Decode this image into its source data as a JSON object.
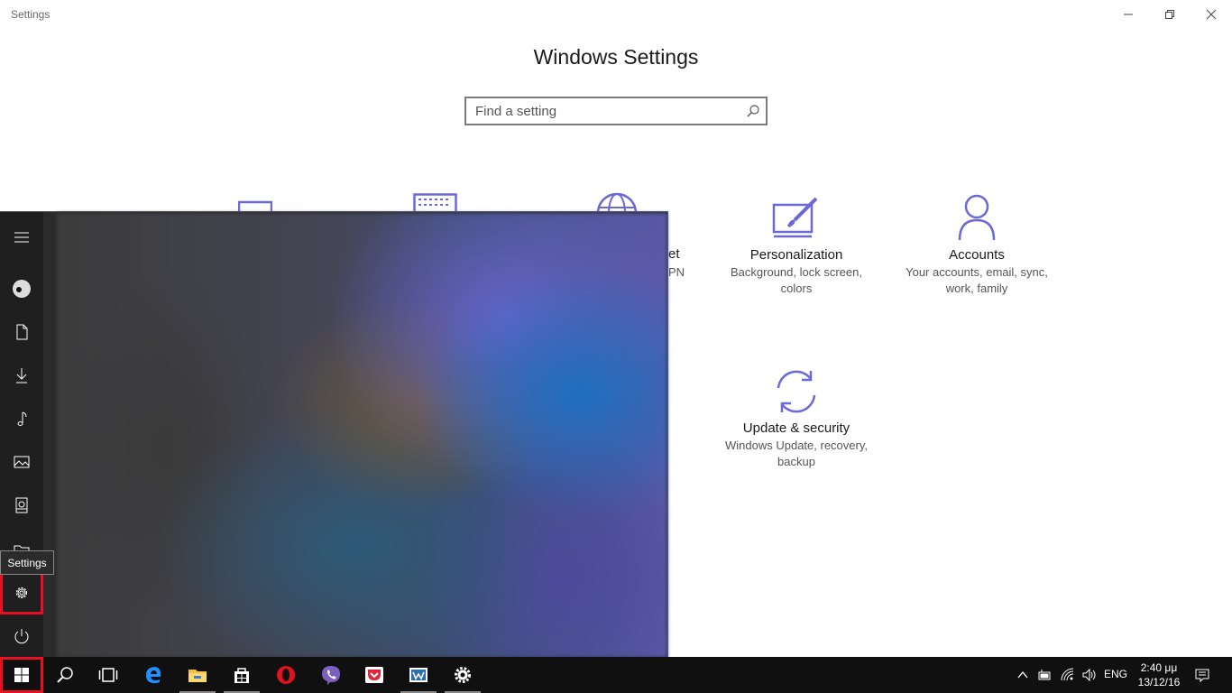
{
  "window": {
    "title": "Settings",
    "controls": [
      "minimize",
      "restore",
      "close"
    ]
  },
  "page": {
    "title": "Windows Settings"
  },
  "search": {
    "placeholder": "Find a setting"
  },
  "tiles": [
    {
      "title": "Personalization",
      "desc": "Background, lock screen, colors",
      "icon": "personalization-icon"
    },
    {
      "title": "Accounts",
      "desc": "Your accounts, email, sync, work, family",
      "icon": "accounts-icon"
    },
    {
      "title": "Update & security",
      "desc": "Windows Update, recovery, backup",
      "icon": "update-security-icon"
    }
  ],
  "partial": {
    "network_title_fragment": "et",
    "network_desc_fragment": "PN"
  },
  "start_menu": {
    "rail_items": [
      "hamburger-icon",
      "user-avatar-icon",
      "documents-icon",
      "downloads-icon",
      "music-icon",
      "pictures-icon",
      "videos-icon",
      "file-explorer-icon",
      "settings-icon",
      "power-icon"
    ],
    "tooltip": "Settings"
  },
  "taskbar": {
    "apps": [
      "start-icon",
      "search-icon",
      "task-view-icon",
      "edge-icon",
      "file-explorer-icon",
      "store-icon",
      "opera-icon",
      "viber-icon",
      "pocket-icon",
      "wps-icon",
      "settings-icon"
    ],
    "tray": [
      "chevron-up-icon",
      "battery-icon",
      "wifi-icon",
      "volume-icon"
    ],
    "language": "ENG",
    "time": "2:40 μμ",
    "date": "13/12/16",
    "action_center": "action-center-icon"
  },
  "colors": {
    "accent": "#6b69d6",
    "highlight": "#e81123",
    "taskbar": "#101010"
  }
}
